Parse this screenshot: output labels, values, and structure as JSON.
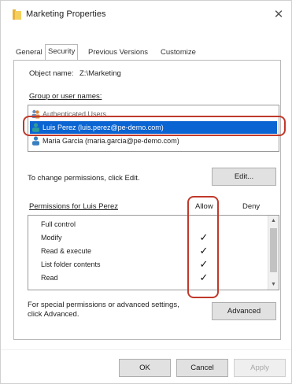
{
  "window": {
    "title": "Marketing Properties",
    "close_symbol": "✕",
    "folder_icon": "folder-icon"
  },
  "tabs": [
    {
      "label": "General",
      "active": false
    },
    {
      "label": "Security",
      "active": true
    },
    {
      "label": "Previous Versions",
      "active": false
    },
    {
      "label": "Customize",
      "active": false
    }
  ],
  "object": {
    "label": "Object name:",
    "value": "Z:\\Marketing"
  },
  "groups": {
    "label": "Group or user names:",
    "items": [
      {
        "name": "Authenticated Users",
        "icon": "users-group-icon",
        "selected": false,
        "faded": true
      },
      {
        "name": "Luis Perez (luis.perez@pe-demo.com)",
        "icon": "user-icon",
        "selected": true,
        "faded": false
      },
      {
        "name": "Maria Garcia (maria.garcia@pe-demo.com)",
        "icon": "user-icon",
        "selected": false,
        "faded": false
      }
    ]
  },
  "change_hint": "To change permissions, click Edit.",
  "edit_button": "Edit...",
  "permissions": {
    "label": "Permissions for Luis Perez",
    "allow_header": "Allow",
    "deny_header": "Deny",
    "check_symbol": "✓",
    "rows": [
      {
        "name": "Full control",
        "allow": false,
        "deny": false
      },
      {
        "name": "Modify",
        "allow": true,
        "deny": false
      },
      {
        "name": "Read & execute",
        "allow": true,
        "deny": false
      },
      {
        "name": "List folder contents",
        "allow": true,
        "deny": false
      },
      {
        "name": "Read",
        "allow": true,
        "deny": false
      }
    ],
    "scroll_up": "▲",
    "scroll_down": "▼"
  },
  "special_hint_line1": "For special permissions or advanced settings,",
  "special_hint_line2": "click Advanced.",
  "advanced_button": "Advanced",
  "footer": {
    "ok": "OK",
    "cancel": "Cancel",
    "apply": "Apply"
  },
  "colors": {
    "selection": "#0a64d2",
    "highlight_box": "#c0392b"
  }
}
